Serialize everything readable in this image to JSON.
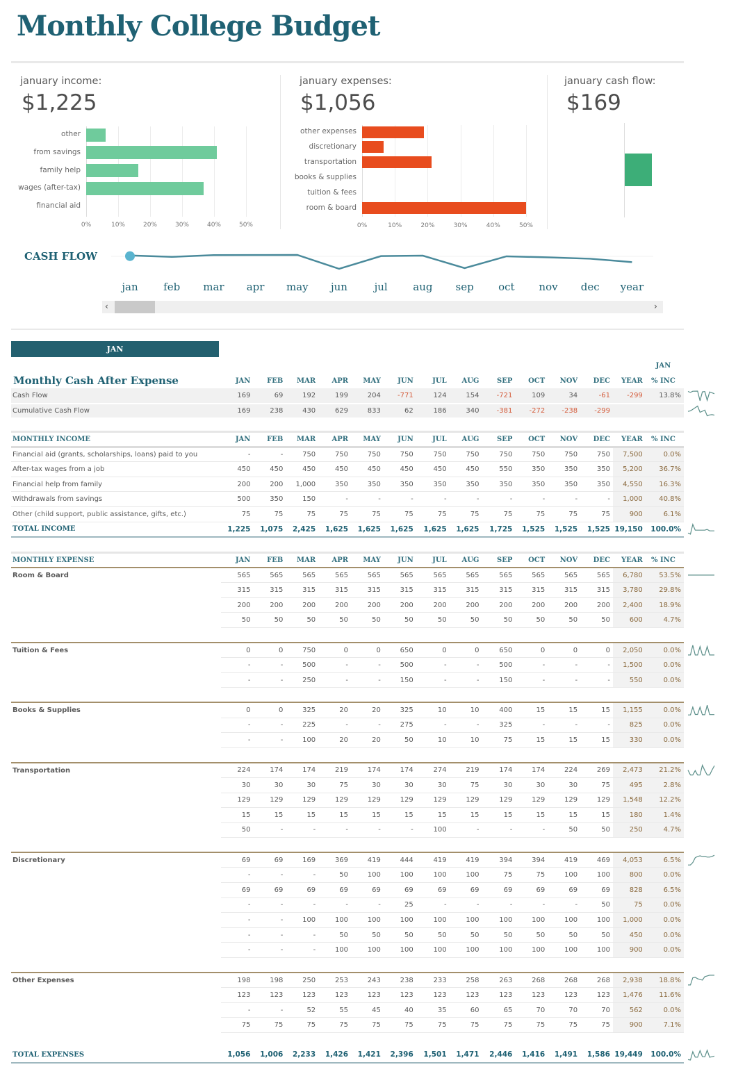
{
  "title": "Monthly College Budget",
  "kpis": {
    "income": {
      "label": "january income:",
      "value": "$1,225"
    },
    "expenses": {
      "label": "january expenses:",
      "value": "$1,056"
    },
    "cashflow": {
      "label": "january cash flow:",
      "value": "$169"
    }
  },
  "chart_data": [
    {
      "type": "bar",
      "title": "january income",
      "orientation": "horizontal",
      "categories": [
        "other",
        "from savings",
        "family help",
        "wages (after-tax)",
        "financial aid"
      ],
      "values": [
        6.1,
        40.8,
        16.3,
        36.7,
        0.0
      ],
      "xlim": [
        0,
        50
      ],
      "ticks": [
        "0%",
        "10%",
        "20%",
        "30%",
        "40%",
        "50%"
      ],
      "color": "#6fcb9c"
    },
    {
      "type": "bar",
      "title": "january expenses",
      "orientation": "horizontal",
      "categories": [
        "other expenses",
        "discretionary",
        "transportation",
        "books & supplies",
        "tuition & fees",
        "room & board"
      ],
      "values": [
        18.8,
        6.5,
        21.2,
        0.0,
        0.0,
        50.0
      ],
      "xlim": [
        0,
        50
      ],
      "ticks": [
        "0%",
        "10%",
        "20%",
        "30%",
        "40%",
        "50%"
      ],
      "color": "#e84c1e"
    },
    {
      "type": "bar",
      "title": "january cash flow",
      "values": [
        169
      ],
      "color": "#3dae78"
    },
    {
      "type": "line",
      "title": "CASH FLOW",
      "categories": [
        "jan",
        "feb",
        "mar",
        "apr",
        "may",
        "jun",
        "jul",
        "aug",
        "sep",
        "oct",
        "nov",
        "dec",
        "year"
      ],
      "values": [
        169,
        69,
        192,
        199,
        204,
        -771,
        124,
        154,
        -721,
        109,
        34,
        -61,
        -299
      ],
      "selected": "jan",
      "color": "#4a8a9b"
    }
  ],
  "scrollbar": {
    "left": "‹",
    "right": "›",
    "position": 0.0
  },
  "selected_month_tab": "JAN",
  "months": [
    "JAN",
    "FEB",
    "MAR",
    "APR",
    "MAY",
    "JUN",
    "JUL",
    "AUG",
    "SEP",
    "OCT",
    "NOV",
    "DEC"
  ],
  "cash_section": {
    "title": "Monthly Cash After Expense",
    "year_label": "YEAR",
    "inc_label_top": "JAN",
    "inc_label": "% INC",
    "rows": [
      {
        "label": "Cash Flow",
        "values": [
          "169",
          "69",
          "192",
          "199",
          "204",
          "-771",
          "124",
          "154",
          "-721",
          "109",
          "34",
          "-61"
        ],
        "year": "-299",
        "inc": "13.8%"
      },
      {
        "label": "Cumulative Cash Flow",
        "values": [
          "169",
          "238",
          "430",
          "629",
          "833",
          "62",
          "186",
          "340",
          "-381",
          "-272",
          "-238",
          "-299"
        ],
        "year": "",
        "inc": ""
      }
    ]
  },
  "income_section": {
    "title": "MONTHLY INCOME",
    "year_label": "YEAR",
    "inc_label": "% INC",
    "rows": [
      {
        "label": "Financial aid (grants, scholarships, loans) paid to you",
        "values": [
          "-",
          "-",
          "750",
          "750",
          "750",
          "750",
          "750",
          "750",
          "750",
          "750",
          "750",
          "750"
        ],
        "year": "7,500",
        "inc": "0.0%"
      },
      {
        "label": "After-tax wages from a job",
        "values": [
          "450",
          "450",
          "450",
          "450",
          "450",
          "450",
          "450",
          "450",
          "550",
          "350",
          "350",
          "350"
        ],
        "year": "5,200",
        "inc": "36.7%"
      },
      {
        "label": "Financial help from family",
        "values": [
          "200",
          "200",
          "1,000",
          "350",
          "350",
          "350",
          "350",
          "350",
          "350",
          "350",
          "350",
          "350"
        ],
        "year": "4,550",
        "inc": "16.3%"
      },
      {
        "label": "Withdrawals from savings",
        "values": [
          "500",
          "350",
          "150",
          "-",
          "-",
          "-",
          "-",
          "-",
          "-",
          "-",
          "-",
          "-"
        ],
        "year": "1,000",
        "inc": "40.8%"
      },
      {
        "label": "Other (child support, public assistance, gifts, etc.)",
        "values": [
          "75",
          "75",
          "75",
          "75",
          "75",
          "75",
          "75",
          "75",
          "75",
          "75",
          "75",
          "75"
        ],
        "year": "900",
        "inc": "6.1%"
      }
    ],
    "total": {
      "label": "TOTAL INCOME",
      "values": [
        "1,225",
        "1,075",
        "2,425",
        "1,625",
        "1,625",
        "1,625",
        "1,625",
        "1,625",
        "1,725",
        "1,525",
        "1,525",
        "1,525"
      ],
      "year": "19,150",
      "inc": "100.0%"
    }
  },
  "expense_section": {
    "title": "MONTHLY EXPENSE",
    "year_label": "YEAR",
    "inc_label": "% INC",
    "categories": [
      {
        "label": "Room & Board",
        "rows": [
          {
            "values": [
              "565",
              "565",
              "565",
              "565",
              "565",
              "565",
              "565",
              "565",
              "565",
              "565",
              "565",
              "565"
            ],
            "year": "6,780",
            "inc": "53.5%"
          },
          {
            "values": [
              "315",
              "315",
              "315",
              "315",
              "315",
              "315",
              "315",
              "315",
              "315",
              "315",
              "315",
              "315"
            ],
            "year": "3,780",
            "inc": "29.8%"
          },
          {
            "values": [
              "200",
              "200",
              "200",
              "200",
              "200",
              "200",
              "200",
              "200",
              "200",
              "200",
              "200",
              "200"
            ],
            "year": "2,400",
            "inc": "18.9%"
          },
          {
            "values": [
              "50",
              "50",
              "50",
              "50",
              "50",
              "50",
              "50",
              "50",
              "50",
              "50",
              "50",
              "50"
            ],
            "year": "600",
            "inc": "4.7%"
          }
        ]
      },
      {
        "label": "Tuition & Fees",
        "rows": [
          {
            "values": [
              "0",
              "0",
              "750",
              "0",
              "0",
              "650",
              "0",
              "0",
              "650",
              "0",
              "0",
              "0"
            ],
            "year": "2,050",
            "inc": "0.0%"
          },
          {
            "values": [
              "-",
              "-",
              "500",
              "-",
              "-",
              "500",
              "-",
              "-",
              "500",
              "-",
              "-",
              "-"
            ],
            "year": "1,500",
            "inc": "0.0%"
          },
          {
            "values": [
              "-",
              "-",
              "250",
              "-",
              "-",
              "150",
              "-",
              "-",
              "150",
              "-",
              "-",
              "-"
            ],
            "year": "550",
            "inc": "0.0%"
          }
        ]
      },
      {
        "label": "Books & Supplies",
        "rows": [
          {
            "values": [
              "0",
              "0",
              "325",
              "20",
              "20",
              "325",
              "10",
              "10",
              "400",
              "15",
              "15",
              "15"
            ],
            "year": "1,155",
            "inc": "0.0%"
          },
          {
            "values": [
              "-",
              "-",
              "225",
              "-",
              "-",
              "275",
              "-",
              "-",
              "325",
              "-",
              "-",
              "-"
            ],
            "year": "825",
            "inc": "0.0%"
          },
          {
            "values": [
              "-",
              "-",
              "100",
              "20",
              "20",
              "50",
              "10",
              "10",
              "75",
              "15",
              "15",
              "15"
            ],
            "year": "330",
            "inc": "0.0%"
          }
        ]
      },
      {
        "label": "Transportation",
        "rows": [
          {
            "values": [
              "224",
              "174",
              "174",
              "219",
              "174",
              "174",
              "274",
              "219",
              "174",
              "174",
              "224",
              "269"
            ],
            "year": "2,473",
            "inc": "21.2%"
          },
          {
            "values": [
              "30",
              "30",
              "30",
              "75",
              "30",
              "30",
              "30",
              "75",
              "30",
              "30",
              "30",
              "75"
            ],
            "year": "495",
            "inc": "2.8%"
          },
          {
            "values": [
              "129",
              "129",
              "129",
              "129",
              "129",
              "129",
              "129",
              "129",
              "129",
              "129",
              "129",
              "129"
            ],
            "year": "1,548",
            "inc": "12.2%"
          },
          {
            "values": [
              "15",
              "15",
              "15",
              "15",
              "15",
              "15",
              "15",
              "15",
              "15",
              "15",
              "15",
              "15"
            ],
            "year": "180",
            "inc": "1.4%"
          },
          {
            "values": [
              "50",
              "-",
              "-",
              "-",
              "-",
              "-",
              "100",
              "-",
              "-",
              "-",
              "50",
              "50"
            ],
            "year": "250",
            "inc": "4.7%"
          }
        ]
      },
      {
        "label": "Discretionary",
        "rows": [
          {
            "values": [
              "69",
              "69",
              "169",
              "369",
              "419",
              "444",
              "419",
              "419",
              "394",
              "394",
              "419",
              "469"
            ],
            "year": "4,053",
            "inc": "6.5%"
          },
          {
            "values": [
              "-",
              "-",
              "-",
              "50",
              "100",
              "100",
              "100",
              "100",
              "75",
              "75",
              "100",
              "100"
            ],
            "year": "800",
            "inc": "0.0%"
          },
          {
            "values": [
              "69",
              "69",
              "69",
              "69",
              "69",
              "69",
              "69",
              "69",
              "69",
              "69",
              "69",
              "69"
            ],
            "year": "828",
            "inc": "6.5%"
          },
          {
            "values": [
              "-",
              "-",
              "-",
              "-",
              "-",
              "25",
              "-",
              "-",
              "-",
              "-",
              "-",
              "50"
            ],
            "year": "75",
            "inc": "0.0%"
          },
          {
            "values": [
              "-",
              "-",
              "100",
              "100",
              "100",
              "100",
              "100",
              "100",
              "100",
              "100",
              "100",
              "100"
            ],
            "year": "1,000",
            "inc": "0.0%"
          },
          {
            "values": [
              "-",
              "-",
              "-",
              "50",
              "50",
              "50",
              "50",
              "50",
              "50",
              "50",
              "50",
              "50"
            ],
            "year": "450",
            "inc": "0.0%"
          },
          {
            "values": [
              "-",
              "-",
              "-",
              "100",
              "100",
              "100",
              "100",
              "100",
              "100",
              "100",
              "100",
              "100"
            ],
            "year": "900",
            "inc": "0.0%"
          }
        ]
      },
      {
        "label": "Other Expenses",
        "rows": [
          {
            "values": [
              "198",
              "198",
              "250",
              "253",
              "243",
              "238",
              "233",
              "258",
              "263",
              "268",
              "268",
              "268"
            ],
            "year": "2,938",
            "inc": "18.8%"
          },
          {
            "values": [
              "123",
              "123",
              "123",
              "123",
              "123",
              "123",
              "123",
              "123",
              "123",
              "123",
              "123",
              "123"
            ],
            "year": "1,476",
            "inc": "11.6%"
          },
          {
            "values": [
              "-",
              "-",
              "52",
              "55",
              "45",
              "40",
              "35",
              "60",
              "65",
              "70",
              "70",
              "70"
            ],
            "year": "562",
            "inc": "0.0%"
          },
          {
            "values": [
              "75",
              "75",
              "75",
              "75",
              "75",
              "75",
              "75",
              "75",
              "75",
              "75",
              "75",
              "75"
            ],
            "year": "900",
            "inc": "7.1%"
          }
        ]
      }
    ],
    "total": {
      "label": "TOTAL EXPENSES",
      "values": [
        "1,056",
        "1,006",
        "2,233",
        "1,426",
        "1,421",
        "2,396",
        "1,501",
        "1,471",
        "2,446",
        "1,416",
        "1,491",
        "1,586"
      ],
      "year": "19,449",
      "inc": "100.0%"
    }
  },
  "colors": {
    "accent": "#1f6173",
    "negative": "#d45b3a",
    "category": "#7b5e2a",
    "sparkline": "#5c8f8a"
  }
}
